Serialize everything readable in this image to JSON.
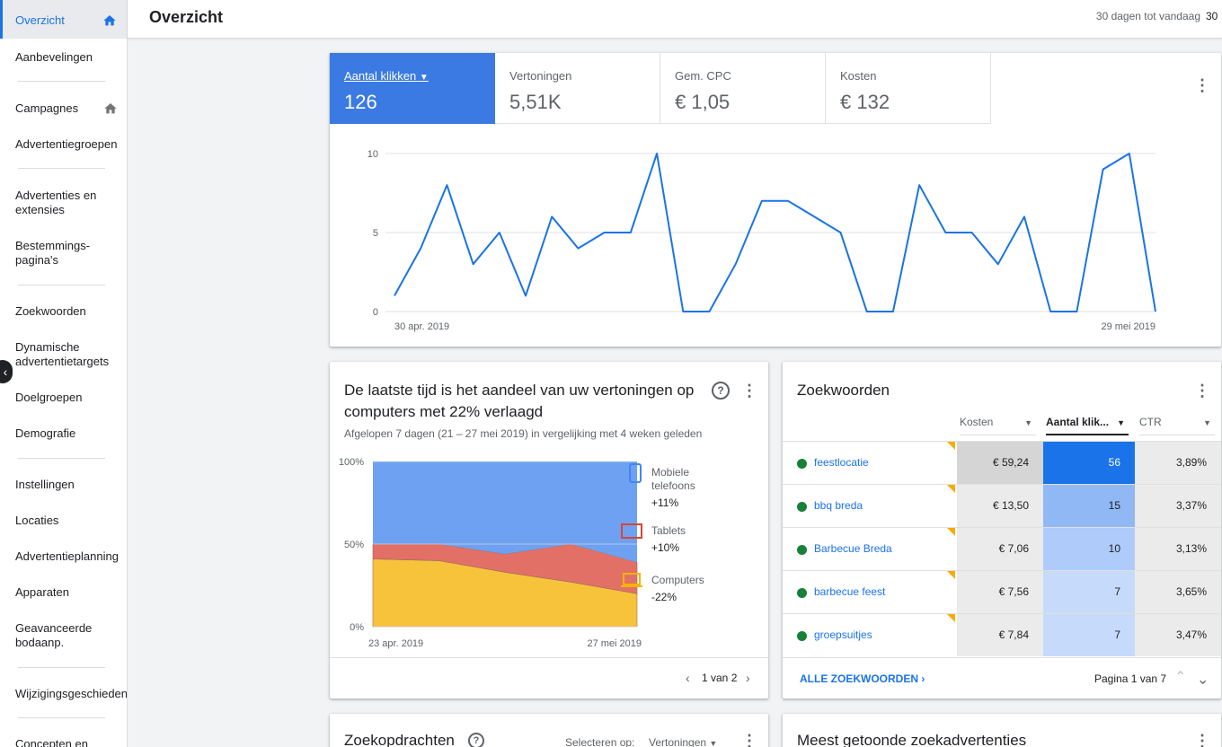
{
  "sidebar": {
    "items": [
      {
        "label": "Overzicht",
        "active": true
      },
      {
        "label": "Aanbevelingen"
      },
      {
        "label": "Campagnes"
      },
      {
        "label": "Advertentiegroepen"
      },
      {
        "label": "Advertenties en extensies"
      },
      {
        "label": "Bestemmings-pagina's"
      },
      {
        "label": "Zoekwoorden"
      },
      {
        "label": "Dynamische advertentietargets"
      },
      {
        "label": "Doelgroepen"
      },
      {
        "label": "Demografie"
      },
      {
        "label": "Instellingen"
      },
      {
        "label": "Locaties"
      },
      {
        "label": "Advertentieplanning"
      },
      {
        "label": "Apparaten"
      },
      {
        "label": "Geavanceerde bodaanp."
      },
      {
        "label": "Wijzigingsgeschiedenis"
      },
      {
        "label": "Concepten en"
      }
    ]
  },
  "header": {
    "title": "Overzicht",
    "date_range": "30 dagen tot vandaag",
    "date_range_short": "30"
  },
  "overview": {
    "metrics": [
      {
        "label": "Aantal klikken",
        "value": "126",
        "active": true
      },
      {
        "label": "Vertoningen",
        "value": "5,51K"
      },
      {
        "label": "Gem. CPC",
        "value": "€ 1,05"
      },
      {
        "label": "Kosten",
        "value": "€ 132"
      }
    ],
    "chart_data": {
      "type": "line",
      "series": [
        {
          "values": [
            1,
            4,
            8,
            3,
            5,
            1,
            6,
            4,
            5,
            5,
            10,
            0,
            0,
            3,
            7,
            7,
            6,
            5,
            0,
            0,
            8,
            5,
            5,
            3,
            6,
            0,
            0,
            9,
            10,
            0
          ]
        }
      ],
      "ylim": [
        0,
        10
      ],
      "yticks": [
        "0",
        "5",
        "10"
      ],
      "xlabels": [
        "30 apr. 2019",
        "29 mei 2019"
      ],
      "color": "#1a73e8"
    }
  },
  "share": {
    "title": "De laatste tijd is het aandeel van uw vertoningen op computers met 22% verlaagd",
    "subtitle": "Afgelopen 7 dagen (21 – 27 mei 2019) in vergelijking met 4 weken geleden",
    "chart_data": {
      "type": "area",
      "stacked": true,
      "percent": true,
      "x": [
        "23 apr. 2019",
        "",
        "",
        "",
        "27 mei 2019"
      ],
      "series": [
        {
          "name": "Computers",
          "values": [
            41,
            40,
            33,
            27,
            20
          ],
          "color": "#f6c33b"
        },
        {
          "name": "Tablets",
          "values": [
            9,
            10,
            11,
            23,
            19
          ],
          "color": "#e37066"
        },
        {
          "name": "Mobiele telefoons",
          "values": [
            50,
            50,
            56,
            50,
            61
          ],
          "color": "#6ea1f1"
        }
      ],
      "yticks": [
        "0%",
        "50%",
        "100%"
      ]
    },
    "legend": [
      {
        "name": "Mobiele telefoons",
        "change": "+11%",
        "color": "#4285f4",
        "icon": "phone-icon"
      },
      {
        "name": "Tablets",
        "change": "+10%",
        "color": "#db4437",
        "icon": "tablet-icon"
      },
      {
        "name": "Computers",
        "change": "-22%",
        "color": "#f4b400",
        "icon": "laptop-icon"
      }
    ],
    "pager": "1 van 2"
  },
  "keywords": {
    "title": "Zoekwoorden",
    "columns": [
      "Kosten",
      "Aantal klik...",
      "CTR"
    ],
    "rows": [
      {
        "name": "feestlocatie",
        "kosten": "€ 59,24",
        "klikken": "56",
        "ctr": "3,89%"
      },
      {
        "name": "bbq breda",
        "kosten": "€ 13,50",
        "klikken": "15",
        "ctr": "3,37%"
      },
      {
        "name": "Barbecue Breda",
        "kosten": "€ 7,06",
        "klikken": "10",
        "ctr": "3,13%"
      },
      {
        "name": "barbecue feest",
        "kosten": "€ 7,56",
        "klikken": "7",
        "ctr": "3,65%"
      },
      {
        "name": "groepsuitjes",
        "kosten": "€ 7,84",
        "klikken": "7",
        "ctr": "3,47%"
      }
    ],
    "all_link": "ALLE ZOEKWOORDEN",
    "pager": "Pagina 1 van 7"
  },
  "bottom_left": {
    "title": "Zoekopdrachten",
    "select_label": "Selecteren op:",
    "select_value": "Vertoningen"
  },
  "bottom_right": {
    "title": "Meest getoonde zoekadvertenties"
  }
}
